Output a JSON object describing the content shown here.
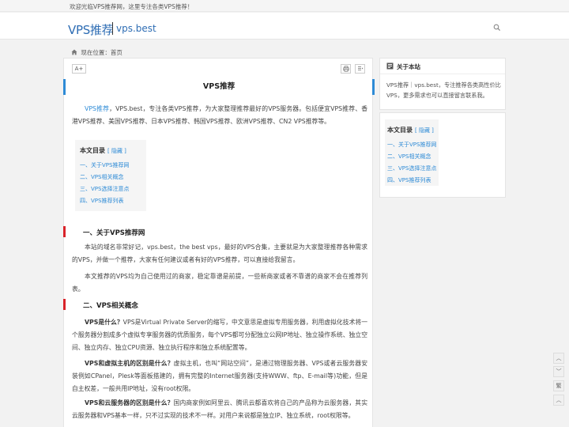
{
  "topbar": {
    "welcome": "欢迎光临VPS推荐网，这里专注各类VPS推荐！"
  },
  "header": {
    "logo_main": "VPS推荐",
    "logo_sub": "vps.best",
    "search_icon": "search-icon"
  },
  "breadcrumb": {
    "label": "现在位置：",
    "current": "首页",
    "icon": "home-icon"
  },
  "toolbar": {
    "font_size": "A+",
    "print_icon": "print-icon",
    "list_icon": "list-icon"
  },
  "article": {
    "title": "VPS推荐",
    "intro_link": "VPS推荐",
    "intro": "，VPS.best，专注各类VPS推荐，为大家整理推荐最好的VPS服务器。包括便宜VPS推荐、香港VPS推荐、美国VPS推荐、日本VPS推荐、韩国VPS推荐、欧洲VPS推荐、CN2 VPS推荐等。",
    "toc": {
      "title": "本文目录",
      "hide": "[ 隐藏 ]",
      "items": [
        "一、关于VPS推荐网",
        "二、VPS相关概念",
        "三、VPS选择注意点",
        "四、VPS推荐列表"
      ]
    },
    "section1": {
      "heading": "一、关于VPS推荐网",
      "p1": "本站的域名非常好记，vps.best，the best vps，最好的VPS合集，主要就是为大家整理推荐各种需求的VPS，并做一个推荐，大家有任何建议或者有好的VPS推荐，可以直接给我留言。",
      "p2": "本文推荐的VPS均为自己使用过的商家，稳定靠谱是前提，一些新商家或者不靠谱的商家不会在推荐列表。"
    },
    "section2": {
      "heading": "二、VPS相关概念",
      "q1": "VPS是什么？",
      "a1": "VPS是Virtual Private Server的缩写，中文意思是虚拟专用服务器，利用虚拟化技术将一个服务器分割成多个虚拟专享服务器的优质服务，每个VPS都可分配独立公网IP地址、独立操作系统、独立空间、独立内存、独立CPU资源、独立执行程序和独立系统配置等。",
      "q2": "VPS和虚拟主机的区别是什么？",
      "a2": "虚拟主机，也叫“网站空间”，是通过物理服务器、VPS或者云服务器安装例如CPanel，Plesk等面板搭建的，拥有完整的Internet服务器(支持WWW、ftp、E-mail等)功能，但是自主权差，一般共用IP地址，没有root权限。",
      "q3": "VPS和云服务器的区别是什么？",
      "a3": "国内商家例如阿里云、腾讯云都喜欢将自己的产品称为云服务器，其实云服务器和VPS基本一样，只不过实现的技术不一样。对用户来说都是独立IP、独立系统，root权限等。"
    }
  },
  "sidebar": {
    "about": {
      "title": "关于本站",
      "text": "VPS推荐｜vps.best，专注推荐各类高性价比VPS，更多需求也可以直接留言联系我。",
      "icon": "info-icon"
    },
    "toc": {
      "title": "本文目录",
      "hide": "[ 隐藏 ]",
      "items": [
        "一、关于VPS推荐网",
        "二、VPS相关概念",
        "三、VPS选择注意点",
        "四、VPS推荐列表"
      ]
    }
  },
  "floating": {
    "up": "︿",
    "down": "﹀",
    "trad": "繁",
    "top": "︿"
  },
  "colors": {
    "brand": "#2e6db4",
    "link": "#2e8bd6",
    "heading_bar": "#d9232a"
  }
}
